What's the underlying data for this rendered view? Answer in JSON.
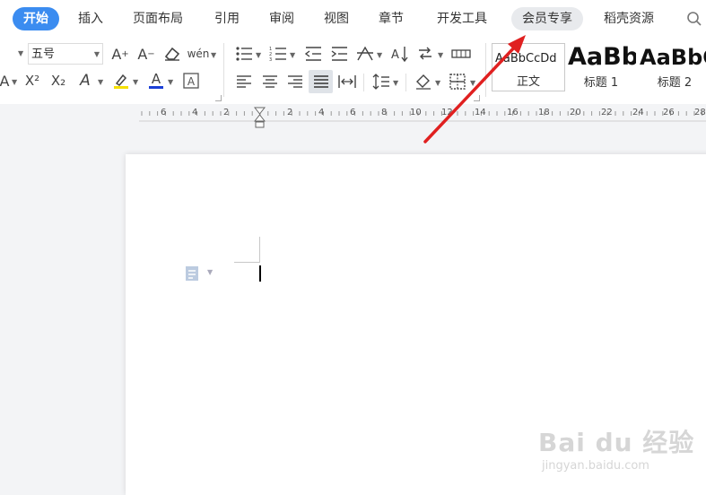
{
  "menu": {
    "tabs": [
      {
        "label": "开始",
        "active": true
      },
      {
        "label": "插入"
      },
      {
        "label": "页面布局"
      },
      {
        "label": "引用"
      },
      {
        "label": "审阅"
      },
      {
        "label": "视图"
      },
      {
        "label": "章节"
      },
      {
        "label": "开发工具"
      },
      {
        "label": "会员专享"
      },
      {
        "label": "稻壳资源"
      }
    ]
  },
  "ribbon": {
    "font_size_value": "五号",
    "phonetic_label": "wén",
    "superscript": "X²",
    "subscript": "X₂"
  },
  "styles": [
    {
      "sample": "AaBbCcDd",
      "name": "正文"
    },
    {
      "sample": "AaBb",
      "name": "标题 1"
    },
    {
      "sample": "AaBbC",
      "name": "标题 2"
    }
  ],
  "ruler": {
    "labels": [
      "6",
      "4",
      "2",
      "2",
      "4",
      "6",
      "8",
      "10",
      "12",
      "14",
      "16",
      "18",
      "20",
      "22",
      "24",
      "26",
      "28"
    ]
  },
  "watermark": {
    "brand": "Bai du 经验",
    "url": "jingyan.baidu.com"
  },
  "colors": {
    "accent": "#3b8cf0",
    "arrow": "#e02020",
    "highlight": "#f5e000",
    "font_color": "#1a3fd6"
  }
}
